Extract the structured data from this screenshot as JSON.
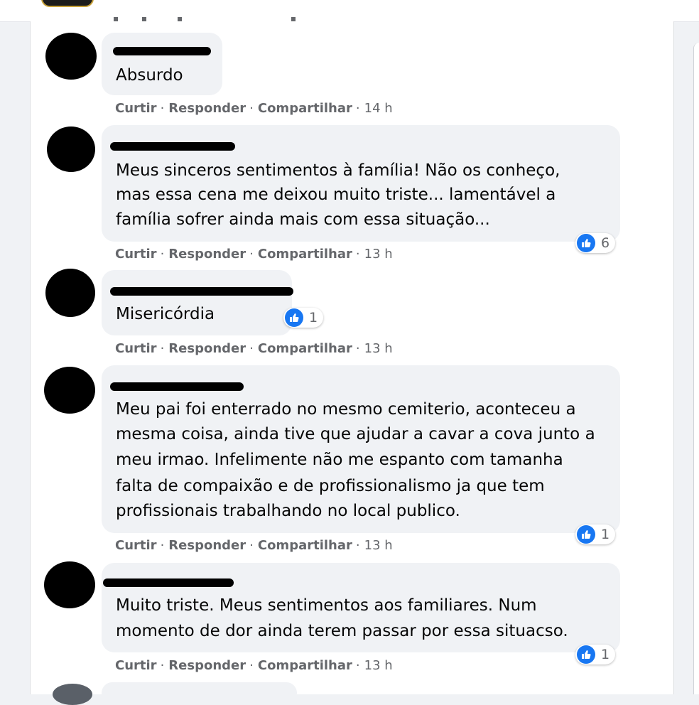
{
  "colors": {
    "accent": "#1877f2",
    "bubble": "#f0f2f5",
    "muted": "#65676b",
    "redaction": "#000000"
  },
  "actions": {
    "like": "Curtir",
    "reply": "Responder",
    "share": "Compartilhar",
    "separator": "·"
  },
  "comments": [
    {
      "lines": [
        "Absurdo"
      ],
      "time": "14 h",
      "reactions": null
    },
    {
      "lines": [
        "Meus sinceros sentimentos à família! Não os conheço,",
        "mas essa cena me deixou muito triste... lamentável a",
        "família sofrer ainda mais com essa situação..."
      ],
      "time": "13 h",
      "reactions": "6"
    },
    {
      "lines": [
        "Misericórdia"
      ],
      "time": "13 h",
      "reactions": "1"
    },
    {
      "lines": [
        "Meu pai foi enterrado no mesmo cemiterio, aconteceu a",
        "mesma coisa, ainda tive que ajudar a cavar a cova junto a",
        "meu irmao. Infelimente não me espanto com tamanha",
        "falta de compaixão e de profissionalismo ja que tem",
        "profissionais trabalhando no local publico."
      ],
      "time": "13 h",
      "reactions": "1"
    },
    {
      "lines": [
        "Muito triste. Meus sentimentos aos familiares. Num",
        "momento de dor ainda terem passar por essa situacso."
      ],
      "time": "13 h",
      "reactions": "1"
    }
  ],
  "icons": {
    "reaction": "like-icon"
  }
}
